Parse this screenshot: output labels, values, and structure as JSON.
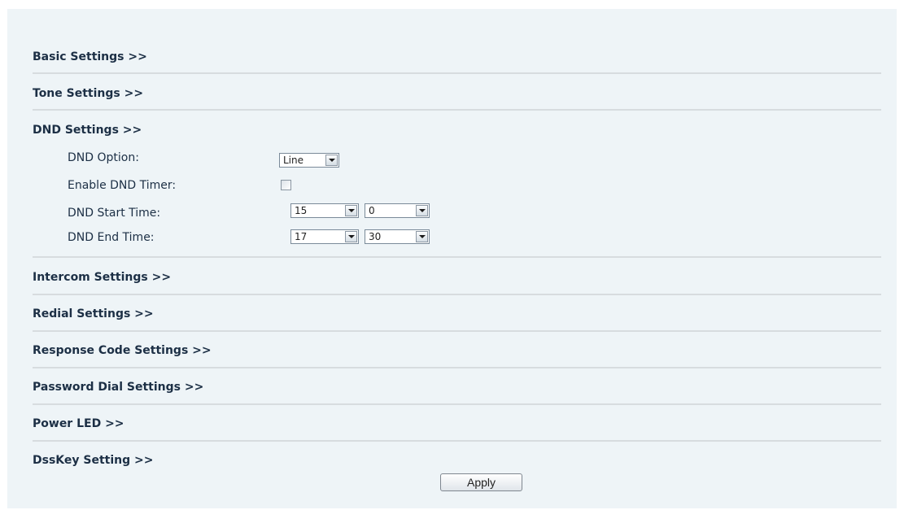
{
  "sections": {
    "basic": "Basic Settings >>",
    "tone": "Tone Settings >>",
    "dnd": "DND Settings >>",
    "intercom": "Intercom Settings >>",
    "redial": "Redial Settings >>",
    "response_code": "Response Code Settings >>",
    "password_dial": "Password Dial Settings >>",
    "power_led": "Power LED >>",
    "dsskey": "DssKey Setting >>"
  },
  "dnd": {
    "option_label": "DND Option:",
    "option_value": "Line",
    "timer_label": "Enable DND Timer:",
    "timer_checked": false,
    "start_label": "DND Start Time:",
    "start_hour": "15",
    "start_minute": "0",
    "end_label": "DND End Time:",
    "end_hour": "17",
    "end_minute": "30"
  },
  "apply_label": "Apply"
}
